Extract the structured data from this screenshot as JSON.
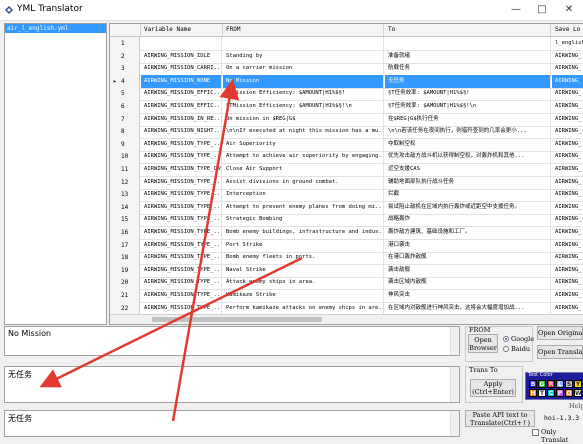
{
  "window": {
    "title": "YML Translator",
    "minimize": "—",
    "maximize": "□",
    "close": "✕"
  },
  "files": [
    "air_l_english.yml"
  ],
  "columns": [
    "Variable Name",
    "FROM",
    "To",
    "Save Lo"
  ],
  "rows": [
    {
      "n": "1",
      "var": "",
      "from": "",
      "to": "",
      "save": "l_english"
    },
    {
      "n": "2",
      "var": "AIRWING_MISSION_IDLE",
      "from": "Standing by",
      "to": "准备就绪",
      "save": "AIRWING_"
    },
    {
      "n": "3",
      "var": "AIRWING_MISSION_CARRI...",
      "from": "On a carrier mission",
      "to": "航载任务",
      "save": "AIRWING_"
    },
    {
      "n": "4",
      "var": "AIRWING_MISSION_NONE",
      "from": "No Mission",
      "to": "无任务",
      "save": "AIRWING_"
    },
    {
      "n": "5",
      "var": "AIRWING_MISSION_EFFIC...",
      "from": "§TMission Efficiency: $AMOUNT|H1%$§!",
      "to": "§T任务效率: $AMOUNT|H1%$§!",
      "save": "AIRWING_"
    },
    {
      "n": "6",
      "var": "AIRWING_MISSION_EFFIC...",
      "from": "§TMission Efficiency: $AMOUNT|H1%$§!\\n",
      "to": "§T任务效率: $AMOUNT|H1%$§!\\n",
      "save": "AIRWING_"
    },
    {
      "n": "7",
      "var": "AIRWING_MISSION_IN_RE...",
      "from": "On mission in $REG|G$",
      "to": "在$REG|G$执行任务",
      "save": "AIRWING_"
    },
    {
      "n": "8",
      "var": "AIRWING_MISSION_NIGHT...",
      "from": "\\n\\nIf executed at night this mission has a mu...",
      "to": "\\n\\n若该任务在夜间执行，则猎歼查到的几率会更小...",
      "save": "AIRWING_"
    },
    {
      "n": "9",
      "var": "AIRWING_MISSION_TYPE_...",
      "from": "Air Superiority",
      "to": "夺取制空权",
      "save": "AIRWING_"
    },
    {
      "n": "10",
      "var": "AIRWING_MISSION_TYPE_...",
      "from": "Attempt to achieve air superiority by engaging...",
      "to": "优先攻击敌方战斗机以获得制空权，对轰炸机和其他...",
      "save": "AIRWING_"
    },
    {
      "n": "11",
      "var": "AIRWING_MISSION_TYPE_CAS",
      "from": "Close Air Support",
      "to": "近空支援CAS",
      "save": "AIRWING_"
    },
    {
      "n": "12",
      "var": "AIRWING_MISSION_TYPE_...",
      "from": "Assist divisions in ground combat.",
      "to": "辅助地面部队执行战斗任务",
      "save": "AIRWING_"
    },
    {
      "n": "13",
      "var": "AIRWING_MISSION_TYPE_...",
      "from": "Interception",
      "to": "拦截",
      "save": "AIRWING_"
    },
    {
      "n": "14",
      "var": "AIRWING_MISSION_TYPE_...",
      "from": "Attempt to prevent enemy planes from doing mi...",
      "to": "尝试阻止敌机在区域内执行轰炸或近距空中支援任务。",
      "save": "AIRWING_"
    },
    {
      "n": "15",
      "var": "AIRWING_MISSION_TYPE_...",
      "from": "Strategic Bombing",
      "to": "战略轰炸",
      "save": "AIRWING_"
    },
    {
      "n": "16",
      "var": "AIRWING_MISSION_TYPE_...",
      "from": "Bomb enemy buildings, infrastructure and indus...",
      "to": "轰炸敌方建筑、基础设施和工厂。",
      "save": "AIRWING_"
    },
    {
      "n": "17",
      "var": "AIRWING_MISSION_TYPE_...",
      "from": "Port Strike",
      "to": "港口袭击",
      "save": "AIRWING_"
    },
    {
      "n": "18",
      "var": "AIRWING_MISSION_TYPE_...",
      "from": "Bomb enemy fleets in ports.",
      "to": "在港口轰炸敌舰",
      "save": "AIRWING_"
    },
    {
      "n": "19",
      "var": "AIRWING_MISSION_TYPE_...",
      "from": "Naval Strike",
      "to": "袭击敌舰",
      "save": "AIRWING_"
    },
    {
      "n": "20",
      "var": "AIRWING_MISSION_TYPE_...",
      "from": "Attack enemy ships in area.",
      "to": "袭击区域内敌舰",
      "save": "AIRWING_"
    },
    {
      "n": "21",
      "var": "AIRWING_MISSION_TYPE_...",
      "from": "Kamikaze Strike",
      "to": "神风突击",
      "save": "AIRWING_"
    },
    {
      "n": "22",
      "var": "AIRWING_MISSION_TYPE_...",
      "from": "Perform kamikaze attacks on enemy ships in are...",
      "to": "在区域内对敌舰进行神风突击，这将会大幅度增加战...",
      "save": "AIRWING_"
    }
  ],
  "selected_row": "4",
  "source_text": "No Mission",
  "target_text": "无任务",
  "saved_text": "无任务",
  "from_panel": {
    "label": "FROM",
    "open_browser": "Open\nBrowser",
    "google": "Google",
    "baidu": "Baidu"
  },
  "right_buttons": {
    "open_original": "Open Original",
    "open_translate": "Open Translate"
  },
  "trans_panel": {
    "label": "Trans To",
    "apply": "Apply\n(Ctrl+Enter)"
  },
  "paste_button": "Paste API text to\nTranslate(Ctrl+↑)",
  "text_color": {
    "title": "Text Color",
    "rows": [
      [
        "B",
        "G",
        "R",
        "L",
        "S",
        "Y"
      ],
      [
        "H",
        "T",
        "C",
        "P",
        "O",
        "W"
      ]
    ],
    "colors": [
      "#1a1aff",
      "#18c018",
      "#e02020",
      "#8ab0ff",
      "#c8c8c8",
      "#ffd800",
      "#ff8c00",
      "#ffffff",
      "#00cccc",
      "#c050e0",
      "#ff8030",
      "#ffffff"
    ]
  },
  "help_label": "Help",
  "version_label": "hoi-1.3.3",
  "only_translate_label": "Only Translat",
  "bottom_partial": "Undo tax"
}
